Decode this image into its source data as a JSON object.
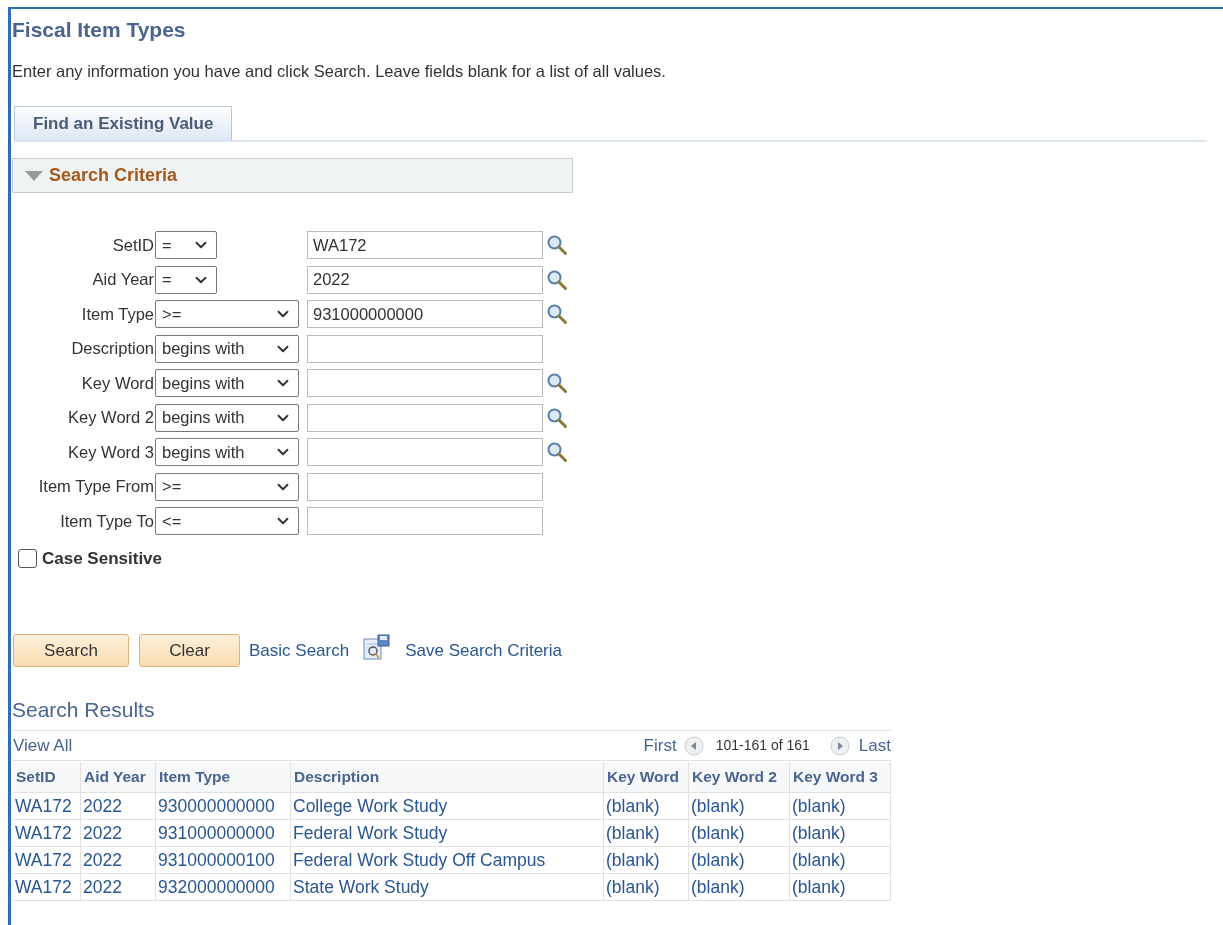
{
  "page": {
    "title": "Fiscal Item Types",
    "instructions": "Enter any information you have and click Search. Leave fields blank for a list of all values."
  },
  "tabs": [
    {
      "label": "Find an Existing Value",
      "selected": true
    }
  ],
  "search_criteria": {
    "title": "Search Criteria",
    "expanded": true,
    "fields": [
      {
        "label": "SetID",
        "operator": "=",
        "kind": "narrow",
        "value": "WA172",
        "lookup": true
      },
      {
        "label": "Aid Year",
        "operator": "=",
        "kind": "narrow",
        "value": "2022",
        "lookup": true
      },
      {
        "label": "Item Type",
        "operator": ">=",
        "kind": "wide",
        "value": "931000000000",
        "lookup": true
      },
      {
        "label": "Description",
        "operator": "begins with",
        "kind": "wide",
        "lookup": false
      },
      {
        "label": "Key Word",
        "operator": "begins with",
        "kind": "wide",
        "lookup": true
      },
      {
        "label": "Key Word 2",
        "operator": "begins with",
        "kind": "wide",
        "lookup": true
      },
      {
        "label": "Key Word 3",
        "operator": "begins with",
        "kind": "wide",
        "lookup": true
      },
      {
        "label": "Item Type From",
        "operator": ">=",
        "kind": "wide",
        "lookup": false
      },
      {
        "label": "Item Type To",
        "operator": "<=",
        "kind": "wide",
        "lookup": false
      }
    ],
    "case_sensitive": {
      "label": "Case Sensitive",
      "checked": false
    }
  },
  "actions": {
    "buttons": [
      "Search",
      "Clear"
    ],
    "links": [
      "Basic Search",
      "Save Search Criteria"
    ]
  },
  "results": {
    "title": "Search Results",
    "view_all": "View All",
    "pager": {
      "first": "First",
      "range": "101-161 of 161",
      "last": "Last"
    },
    "columns": [
      "SetID",
      "Aid Year",
      "Item Type",
      "Description",
      "Key Word",
      "Key Word 2",
      "Key Word 3"
    ],
    "rows": [
      [
        "WA172",
        "2022",
        "930000000000",
        "College Work Study",
        "(blank)",
        "(blank)",
        "(blank)"
      ],
      [
        "WA172",
        "2022",
        "931000000000",
        "Federal Work Study",
        "(blank)",
        "(blank)",
        "(blank)"
      ],
      [
        "WA172",
        "2022",
        "931000000100",
        "Federal Work Study Off Campus",
        "(blank)",
        "(blank)",
        "(blank)"
      ],
      [
        "WA172",
        "2022",
        "932000000000",
        "State Work Study",
        "(blank)",
        "(blank)",
        "(blank)"
      ]
    ]
  }
}
